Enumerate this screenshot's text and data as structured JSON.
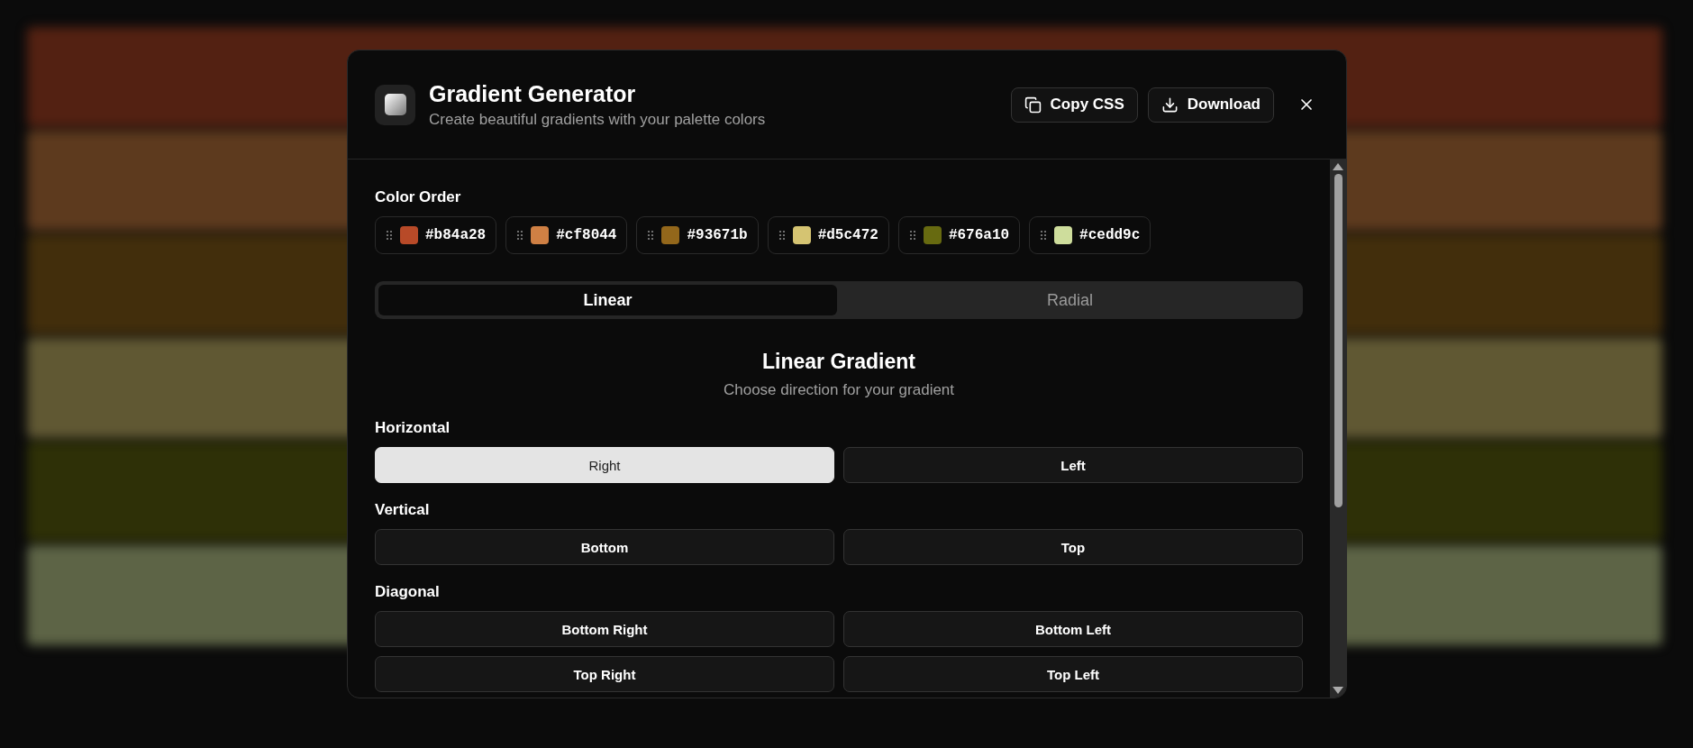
{
  "dialog": {
    "title": "Gradient Generator",
    "subtitle": "Create beautiful gradients with your palette colors",
    "actions": [
      {
        "label": "Copy CSS",
        "kind": "copy"
      },
      {
        "label": "Download",
        "kind": "download"
      }
    ]
  },
  "color_order": {
    "label": "Color Order",
    "colors": [
      {
        "hex": "#b84a28",
        "color": "#b84a28"
      },
      {
        "hex": "#cf8044",
        "color": "#cf8044"
      },
      {
        "hex": "#93671b",
        "color": "#93671b"
      },
      {
        "hex": "#d5c472",
        "color": "#d5c472"
      },
      {
        "hex": "#676a10",
        "color": "#676a10"
      },
      {
        "hex": "#cedd9c",
        "color": "#cedd9c"
      }
    ]
  },
  "tabs": [
    {
      "label": "Linear",
      "selected": true
    },
    {
      "label": "Radial",
      "selected": false
    }
  ],
  "section": {
    "title": "Linear Gradient",
    "subtitle": "Choose direction for your gradient",
    "groups": [
      {
        "label": "Horizontal",
        "options": [
          {
            "label": "Right",
            "selected": true
          },
          {
            "label": "Left",
            "selected": false
          }
        ]
      },
      {
        "label": "Vertical",
        "options": [
          {
            "label": "Bottom",
            "selected": false
          },
          {
            "label": "Top",
            "selected": false
          }
        ]
      },
      {
        "label": "Diagonal",
        "options": [
          {
            "label": "Bottom Right",
            "selected": false
          },
          {
            "label": "Bottom Left",
            "selected": false
          },
          {
            "label": "Top Right",
            "selected": false
          },
          {
            "label": "Top Left",
            "selected": false
          }
        ]
      }
    ]
  }
}
